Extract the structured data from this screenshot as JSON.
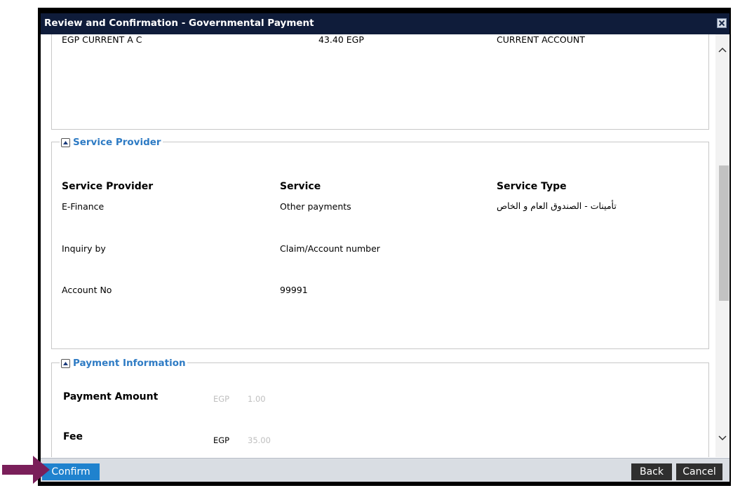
{
  "dialog": {
    "title": "Review and Confirmation - Governmental Payment"
  },
  "account_row": {
    "account": "EGP CURRENT A C",
    "balance": "43.40 EGP",
    "type": "CURRENT ACCOUNT"
  },
  "service_provider_section": {
    "legend": "Service Provider",
    "headers": {
      "provider": "Service Provider",
      "service": "Service",
      "service_type": "Service Type"
    },
    "rows": [
      {
        "label": "E-Finance",
        "value": "Other payments",
        "extra": "تأمينات - الصندوق العام و الخاص"
      },
      {
        "label": "Inquiry by",
        "value": "Claim/Account number"
      },
      {
        "label": "Account No",
        "value": "99991"
      }
    ]
  },
  "payment_section": {
    "legend": "Payment Information",
    "amount_label": "Payment Amount",
    "amount_currency": "EGP",
    "amount_value": "1.00",
    "fee_label": "Fee",
    "fee_currency": "EGP",
    "fee_value": "35.00"
  },
  "footer": {
    "confirm_label": "Confirm",
    "back_label": "Back",
    "cancel_label": "Cancel"
  },
  "colors": {
    "title_bar": "#0f1c3a",
    "legend_text": "#2e7bc4",
    "confirm_button": "#1f82ce",
    "pointer_arrow": "#7a1f5a"
  },
  "icons": [
    "close-icon",
    "collapse-icon",
    "scroll-up-icon",
    "scroll-down-icon",
    "pointer-arrow-icon"
  ]
}
